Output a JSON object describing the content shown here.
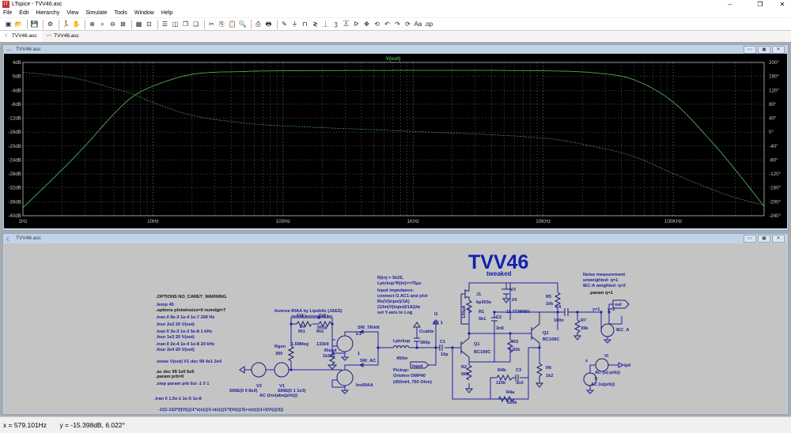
{
  "app": {
    "title": "LTspice - TVV46.asc"
  },
  "menu": [
    "File",
    "Edit",
    "Hierarchy",
    "View",
    "Simulate",
    "Tools",
    "Window",
    "Help"
  ],
  "toolbar": [
    {
      "icon": "new-schematic-icon",
      "glyph": "▣"
    },
    {
      "icon": "open-icon",
      "glyph": "📂"
    },
    {
      "sep": true
    },
    {
      "icon": "save-icon",
      "glyph": "💾"
    },
    {
      "sep": true
    },
    {
      "icon": "control-panel-icon",
      "glyph": "⚙"
    },
    {
      "sep": true
    },
    {
      "icon": "run-icon",
      "glyph": "🏃"
    },
    {
      "icon": "halt-icon",
      "glyph": "✋"
    },
    {
      "sep": true
    },
    {
      "icon": "zoom-in-icon",
      "glyph": "⊕"
    },
    {
      "icon": "pan-icon",
      "glyph": "⌕"
    },
    {
      "icon": "zoom-out-icon",
      "glyph": "⊖"
    },
    {
      "icon": "zoom-fit-icon",
      "glyph": "⊠"
    },
    {
      "sep": true
    },
    {
      "icon": "autorange-icon",
      "glyph": "▦"
    },
    {
      "icon": "fft-icon",
      "glyph": "⊡"
    },
    {
      "sep": true
    },
    {
      "icon": "tile-horizontal-icon",
      "glyph": "☰"
    },
    {
      "icon": "tile-vertical-icon",
      "glyph": "◫"
    },
    {
      "icon": "cascade-icon",
      "glyph": "❐"
    },
    {
      "icon": "close-all-icon",
      "glyph": "❏"
    },
    {
      "sep": true
    },
    {
      "icon": "cut-icon",
      "glyph": "✂"
    },
    {
      "icon": "copy-icon",
      "glyph": "⎘"
    },
    {
      "icon": "paste-icon",
      "glyph": "📋"
    },
    {
      "icon": "find-icon",
      "glyph": "🔍"
    },
    {
      "sep": true
    },
    {
      "icon": "print-setup-icon",
      "glyph": "⎙"
    },
    {
      "icon": "print-icon",
      "glyph": "🖶"
    },
    {
      "sep": true
    },
    {
      "icon": "wire-icon",
      "glyph": "✎"
    },
    {
      "icon": "ground-icon",
      "glyph": "⏚"
    },
    {
      "icon": "label-net-icon",
      "glyph": "⊓"
    },
    {
      "icon": "resistor-icon",
      "glyph": "≷"
    },
    {
      "icon": "capacitor-icon",
      "glyph": "⏊"
    },
    {
      "icon": "inductor-icon",
      "glyph": "ʒ"
    },
    {
      "icon": "diode-icon",
      "glyph": "⏄"
    },
    {
      "icon": "component-icon",
      "glyph": "ᐅ"
    },
    {
      "icon": "move-icon",
      "glyph": "✥"
    },
    {
      "icon": "drag-icon",
      "glyph": "⟲"
    },
    {
      "icon": "undo-icon",
      "glyph": "↶"
    },
    {
      "icon": "redo-icon",
      "glyph": "↷"
    },
    {
      "icon": "rotate-icon",
      "glyph": "⟳"
    },
    {
      "icon": "text-icon",
      "glyph": "Aa"
    },
    {
      "icon": "spice-directive-icon",
      "glyph": ".op"
    }
  ],
  "tabs": [
    {
      "label": "TVV46.asc",
      "icon": "schematic-icon",
      "active": true
    },
    {
      "label": "TVV46.asc",
      "icon": "waveform-icon",
      "active": false
    }
  ],
  "plot_window": {
    "title": "TVV46.asc",
    "buttons": [
      "minimize",
      "maximize",
      "close"
    ]
  },
  "schematic_window": {
    "title": "TVV46.asc",
    "buttons": [
      "minimize",
      "maximize",
      "close"
    ]
  },
  "chart_data": {
    "type": "line",
    "title": "V(out)",
    "xscale": "log",
    "xlim": [
      1,
      500000
    ],
    "xticks": [
      "1Hz",
      "10Hz",
      "100Hz",
      "1KHz",
      "10KHz",
      "100KHz"
    ],
    "xtick_values": [
      1,
      10,
      100,
      1000,
      10000,
      100000
    ],
    "ylim": [
      -40,
      4
    ],
    "yticks": [
      "4dB",
      "0dB",
      "-4dB",
      "-8dB",
      "-12dB",
      "-16dB",
      "-20dB",
      "-24dB",
      "-28dB",
      "-32dB",
      "-36dB",
      "-40dB"
    ],
    "y2lim": [
      -240,
      200
    ],
    "y2ticks": [
      "200°",
      "160°",
      "120°",
      "80°",
      "40°",
      "0°",
      "-40°",
      "-80°",
      "-120°",
      "-160°",
      "-200°",
      "-240°"
    ],
    "grid": true,
    "background": "#000000",
    "trace_color": "#4caf50",
    "x": [
      1,
      2,
      3,
      5,
      7,
      10,
      20,
      50,
      100,
      1000,
      10000,
      25000,
      50000,
      100000,
      200000,
      300000,
      500000
    ],
    "series": [
      {
        "quantity": "magnitude_dB",
        "style": "solid",
        "values": [
          -37.7,
          -26.8,
          -20,
          -10.8,
          -5.8,
          -2.8,
          0.6,
          1.4,
          1.6,
          1.7,
          1.6,
          1.0,
          -1.0,
          -7.4,
          -19,
          -26.8,
          -37.3
        ]
      },
      {
        "quantity": "phase_deg",
        "style": "dashed",
        "values": [
          172,
          160,
          148,
          125,
          109,
          85,
          48,
          26,
          18,
          2,
          -17,
          -42,
          -70,
          -119,
          -165,
          -188,
          -210
        ]
      }
    ]
  },
  "schematic": {
    "title": "TVV46",
    "subtitle": "tweaked",
    "directives": [
      {
        "t": ".OPTIONS NO_CARET_WARNING",
        "k": true
      },
      {
        "t": ".temp 45"
      },
      {
        "t": ".options plotwinsize=0 numdgt=7",
        "k": true
      },
      {
        "t": ".tran 0 8e-3 1e-4 1e-7 200 Hz"
      },
      {
        "t": ".four 2e2 20 V(out)"
      },
      {
        "t": ".tran 0 3e-3 1e-3 5e-8 1 kHz"
      },
      {
        "t": ".four 1e3 20 V(out)"
      },
      {
        "t": ".tran 0 2e-4 1e-4 1e-8 20 kHz"
      },
      {
        "t": ".four 2e4 20 V(out)"
      },
      {
        "t": ".noise V(out) V1 dec 99 4e1 2e4"
      },
      {
        "t": ".ac dec 99 1e0 5e5",
        "k": true
      },
      {
        "t": ".param prb=0",
        "k": true
      },
      {
        "t": ".step param prb list -1 0 1"
      },
      {
        "t": ".tran 0 1.5e-1 1e-5 1e-8"
      },
      {
        "t": "-1/(1-1/(2*(I(Vi)@1*v(x)@3-v(x)@1*I(Vi)@3)+v(x)@1+I(Vi)@3))"
      }
    ],
    "labels": {
      "riaa": "Inverse-RIAA by Lipshitz (JAES)",
      "ct1": "Ct1",
      "ct3": "Ct3",
      "ct1v": "2n",
      "rt1": "Rt1",
      "ct3v": "560p",
      "rt3": "Rt3",
      "rt1v": "1.59Meg",
      "rt3v": "133k9",
      "rgen": "Rgen",
      "rgenv": "300",
      "rload": "Rload",
      "rloadv": "1k102",
      "v2": "V2",
      "v2v": "SINE(0 0 8e3)",
      "v1": "V1",
      "v1v": "SINE(0 1 1e3)",
      "v1ac": "AC {inv(abs(prb))}",
      "e1": "E1",
      "swtran": "SW_TRAN",
      "e1g": "1",
      "swac": "SW_AC",
      "invriaa": "InvRIAA",
      "lpickup": "Lpickup",
      "lpickupv": "450m",
      "ccable": "Ccable",
      "ccablev": "360p",
      "input": "input",
      "pickup1": "Pickup:",
      "pickup2": "Ortofon OMP40",
      "pickup3": "(450mH, 750 Ohm)",
      "note1": "R(in) = 5k25,",
      "note2": "Lpickup*R(in)==75µs",
      "note3": "Input impedance:",
      "note4": "connect I1 AC1 and plot",
      "note5": "Re(V(input)/1A)",
      "note6": "(1/Im(V(input)/1A))/w",
      "note7": "set Y-axis to Log",
      "i1": "I1",
      "i1v": "AC 1",
      "j1": "J1",
      "j1v": "kp303a",
      "r1": "R1",
      "r1v": "5k1",
      "ij": "130µA",
      "v3": "V3",
      "v3v": "24",
      "r5": "R5",
      "r5v": "16k",
      "vnode": "11.773908V",
      "c4": "C4",
      "c4v": "100n",
      "c2": "C2",
      "c2v": "3n9",
      "r7": "R7",
      "r7v": "39k",
      "q2": "Q2",
      "q2v": "BC109C",
      "r3": "R3",
      "r3v": "82k",
      "c1": "C1",
      "c1v": "10p",
      "q1": "Q1",
      "q1v": "BC109C",
      "r2": "R2",
      "r2v": "560",
      "r4b": "R4b",
      "r4bv": "110k",
      "c3": "C3",
      "c3v": "3n3",
      "r4a": "R4a",
      "r4av": "620k",
      "r6": "R6",
      "r6v": "1k2",
      "noise1": "Noise measurement",
      "noise2": "unweighted: q=1",
      "noise3": "IEC-A weighted: q=2",
      "paramq": ".param q=1",
      "out": "out",
      "y1": "y=1",
      "y2": "y=2",
      "ieca": "IEC_A",
      "vi": "Vi",
      "tp0": "tp0",
      "x": "x",
      "viac": "AC {u(-prb)}",
      "ii": "Ii",
      "iiac": "AC {u(prb)}"
    }
  },
  "status": {
    "x": "x = 579.101Hz",
    "y": "y = -15.398dB, 6.022°"
  }
}
